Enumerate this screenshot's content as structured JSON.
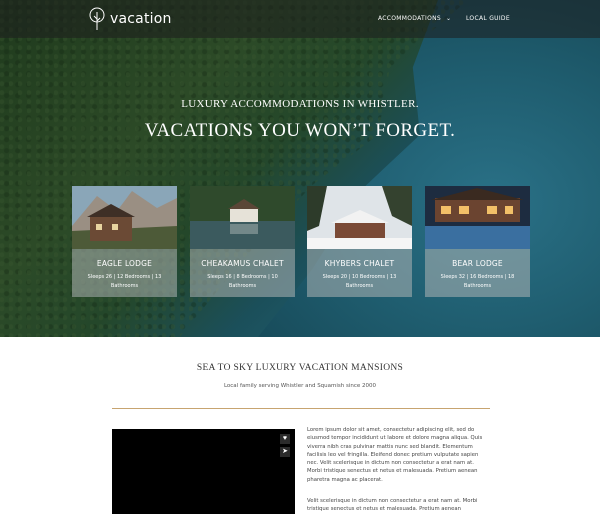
{
  "header": {
    "logo_text": "vacation",
    "nav": [
      {
        "label": "ACCOMMODATIONS",
        "has_dropdown": true
      },
      {
        "label": "LOCAL GUIDE",
        "has_dropdown": false
      }
    ]
  },
  "hero": {
    "subtitle": "LUXURY ACCOMMODATIONS IN WHISTLER.",
    "headline": "VACATIONS YOU WON’T FORGET."
  },
  "cards": [
    {
      "name": "EAGLE LODGE",
      "meta": "Sleeps 26 | 12 Bedrooms | 13 Bathrooms"
    },
    {
      "name": "CHEAKAMUS CHALET",
      "meta": "Sleeps 16 | 8 Bedrooms | 10 Bathrooms"
    },
    {
      "name": "KHYBERS CHALET",
      "meta": "Sleeps 20 | 10 Bedrooms | 13 Bathrooms"
    },
    {
      "name": "BEAR LODGE",
      "meta": "Sleeps 32 | 16 Bedrooms | 18 Bathrooms"
    }
  ],
  "section": {
    "title": "SEA TO SKY LUXURY VACATION MANSIONS",
    "subtitle": "Local family serving Whistler and Squamish since 2000",
    "paragraph1": "Lorem ipsum dolor sit amet, consectetur adipiscing elit, sed do eiusmod tempor incididunt ut labore et dolore magna aliqua. Quis viverra nibh cras pulvinar mattis nunc sed blandit. Elementum facilisis leo vel fringilla. Eleifend donec pretium vulputate sapien nec. Velit scelerisque in dictum non consectetur a erat nam at. Morbi tristique senectus et netus et malesuada. Pretium aenean pharetra magna ac placerat.",
    "paragraph2": "Velit scelerisque in dictum non consectetur a erat nam at. Morbi tristique senectus et netus et malesuada. Pretium aenean"
  },
  "colors": {
    "accent_divider": "#c7a470",
    "topbar": "#1e1e1e"
  },
  "icons": {
    "like": "heart-icon",
    "share": "share-icon",
    "dropdown": "chevron-down-icon"
  }
}
